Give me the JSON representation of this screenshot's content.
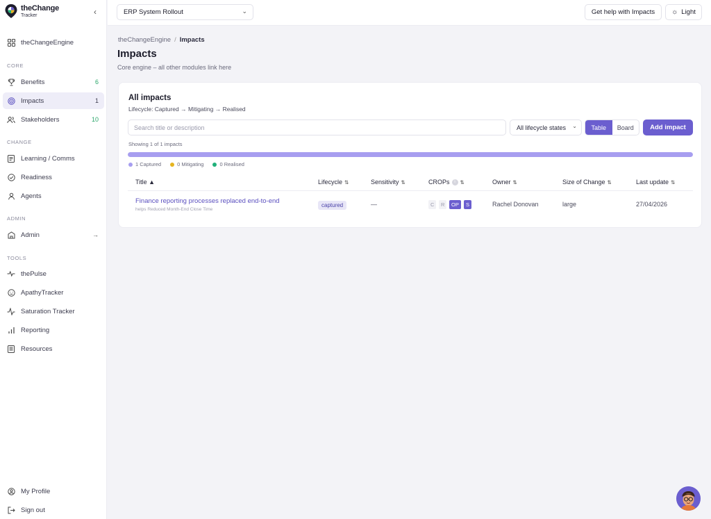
{
  "brand": {
    "title": "theChange",
    "subtitle": "Tracker"
  },
  "sidebar": {
    "home": "theChangeEngine",
    "sections": {
      "core": "CORE",
      "change": "CHANGE",
      "admin": "ADMIN",
      "tools": "TOOLS"
    },
    "core_items": [
      {
        "label": "Benefits",
        "count": "6"
      },
      {
        "label": "Impacts",
        "count": "1"
      },
      {
        "label": "Stakeholders",
        "count": "10"
      }
    ],
    "change_items": [
      {
        "label": "Learning / Comms"
      },
      {
        "label": "Readiness"
      },
      {
        "label": "Agents"
      }
    ],
    "admin_items": [
      {
        "label": "Admin"
      }
    ],
    "tool_items": [
      {
        "label": "thePulse"
      },
      {
        "label": "ApathyTracker"
      },
      {
        "label": "Saturation Tracker"
      },
      {
        "label": "Reporting"
      },
      {
        "label": "Resources"
      }
    ],
    "footer": {
      "profile": "My Profile",
      "signout": "Sign out"
    }
  },
  "topbar": {
    "project": "ERP System Rollout",
    "help": "Get help with Impacts",
    "theme": "Light"
  },
  "page": {
    "breadcrumb_root": "theChangeEngine",
    "breadcrumb_current": "Impacts",
    "title": "Impacts",
    "subtitle": "Core engine – all other modules link here"
  },
  "card": {
    "title": "All impacts",
    "lifecycle": "Lifecycle: Captured → Mitigating → Realised",
    "search_placeholder": "Search title or description",
    "filter": "All lifecycle states",
    "view_table": "Table",
    "view_board": "Board",
    "add": "Add impact",
    "showing": "Showing 1 of 1 impacts",
    "progress_captured_fraction": 1.0,
    "legend": [
      {
        "label": "1 Captured",
        "color": "#a79ef0"
      },
      {
        "label": "0 Mitigating",
        "color": "#e5b420"
      },
      {
        "label": "0 Realised",
        "color": "#20b07a"
      }
    ],
    "columns": [
      "Title ▲",
      "Lifecycle",
      "Sensitivity",
      "CROPs",
      "Owner",
      "Size of Change",
      "Last update"
    ],
    "rows": [
      {
        "title": "Finance reporting processes replaced end-to-end",
        "helps": "helps Reduced Month-End Close Time",
        "lifecycle": "captured",
        "sensitivity": "—",
        "crops": [
          "C",
          "R",
          "OP",
          "S"
        ],
        "owner": "Rachel Donovan",
        "size": "large",
        "updated": "27/04/2026"
      }
    ]
  }
}
